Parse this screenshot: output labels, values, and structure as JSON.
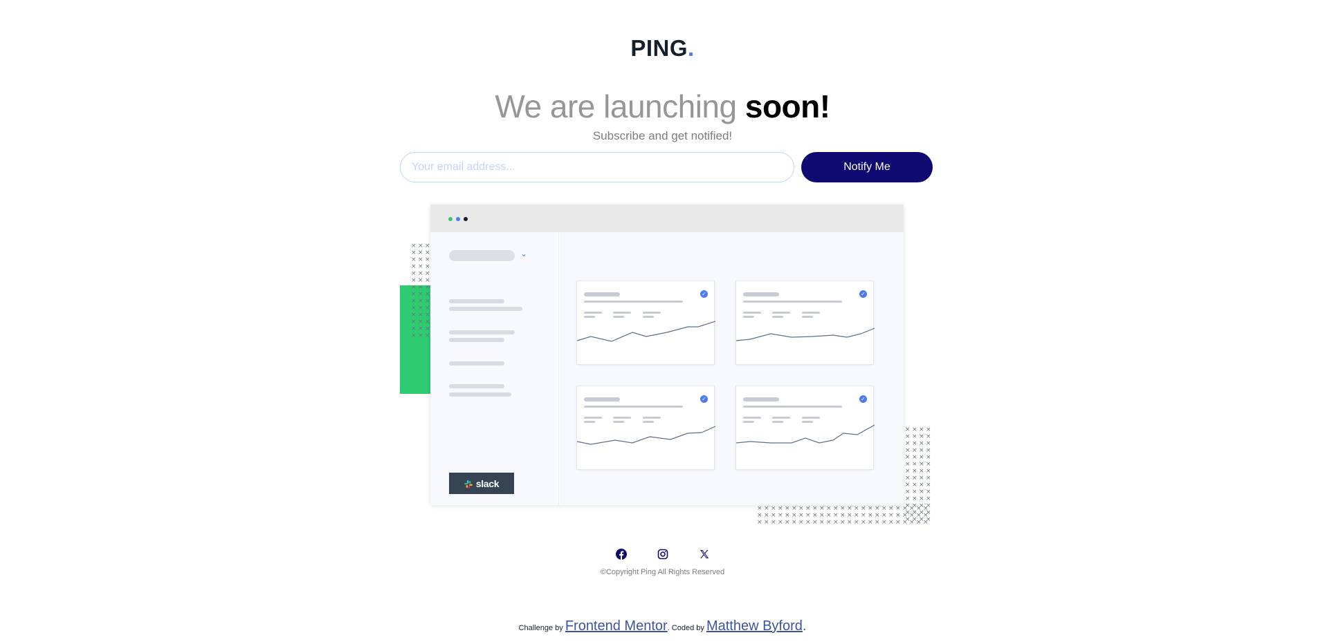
{
  "brand": {
    "name": "PING",
    "dot": ".",
    "accent_color": "#4c7bf3"
  },
  "hero": {
    "headline_light": "We are launching",
    "headline_bold": "soon!",
    "subtitle": "Subscribe and get notified!"
  },
  "form": {
    "email_placeholder": "Your email address...",
    "email_value": "",
    "submit_label": "Notify Me",
    "button_color": "#0f0a72"
  },
  "illustration": {
    "window_dots": [
      "#2ecc71",
      "#4c7bf3",
      "#15202a"
    ],
    "sidebar_badge": "slack",
    "accent_block_color": "#2ecc71"
  },
  "footer": {
    "social_icons": [
      "facebook-icon",
      "instagram-icon",
      "x-twitter-icon"
    ],
    "copyright": "©Copyright Ping All Rights Reserved",
    "attribution": {
      "prefix": "Challenge by",
      "challenge_link": "Frontend Mentor",
      "middle": "Coded by",
      "author_link": "Matthew Byford",
      "suffix": "."
    }
  }
}
